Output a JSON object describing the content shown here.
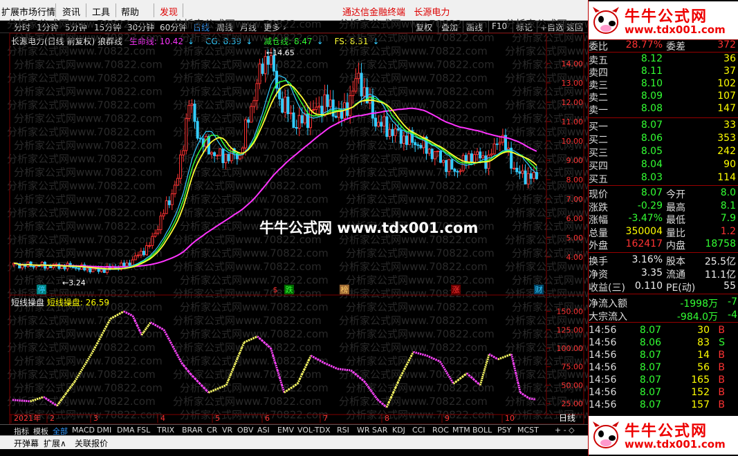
{
  "menu": {
    "items": [
      "扩展市场行情",
      "资讯",
      "工具",
      "帮助"
    ],
    "highlight": "发现",
    "center_title": "通达信金融终端",
    "stock_name": "长源电力"
  },
  "toolbar": {
    "periods": [
      "分时",
      "1分钟",
      "5分钟",
      "15分钟",
      "30分钟",
      "60分钟",
      "日线",
      "周线",
      "月线",
      "更多"
    ],
    "selected": "日线",
    "buttons": [
      "复权",
      "叠加",
      "画线",
      "F10",
      "标记",
      "+自选",
      "返回"
    ]
  },
  "main_chart": {
    "title": "长源电力(日线 前复权) 狼群线",
    "legend": [
      {
        "label": "生命线: 10.42",
        "color": "#ff33ff"
      },
      {
        "label": "CG: 8.39",
        "color": "#33ccff"
      },
      {
        "label": "减仓线: 8.47",
        "color": "#33ff33"
      },
      {
        "label": "FS: 8.31",
        "color": "#ffff33"
      }
    ],
    "arrow_glyph": "↓",
    "y_ticks": [
      "14.00",
      "13.00",
      "12.00",
      "11.00",
      "10.00",
      "9.00",
      "8.00",
      "7.00",
      "6.00",
      "5.00",
      "4.00"
    ],
    "high_label": "14.65",
    "low_label": "3.24",
    "markers": [
      {
        "text": "停",
        "color": "#33ccff",
        "box": "#008080"
      },
      {
        "text": "$",
        "color": "#ff3333",
        "box": ""
      },
      {
        "text": "跌",
        "color": "#33ff33",
        "box": "#006600"
      },
      {
        "text": "榜",
        "color": "#ffcc66",
        "box": "#996633"
      },
      {
        "text": "涨",
        "color": "#ff3333",
        "box": "#660000"
      },
      {
        "text": "财",
        "color": "#33ccff",
        "box": "#004466"
      }
    ],
    "watermark": "分析家公式网www.70822.com",
    "banner": "牛牛公式网 www.tdx001.com"
  },
  "indicator": {
    "name": "短线操盘",
    "value_label": "短线操盘: 26.59",
    "y_ticks": [
      "150.00",
      "125.00",
      "100.00",
      "75.00",
      "50.00",
      "25.00"
    ],
    "months": [
      "2021年",
      "2",
      "3",
      "4",
      "5",
      "6",
      "7",
      "8",
      "9",
      "10"
    ],
    "period_label": "日线"
  },
  "bottom_tabs": [
    "指标",
    "模板",
    "全部",
    "MACD",
    "DMI",
    "DMA",
    "FSL",
    "TRIX",
    "BRAR",
    "CR",
    "VR",
    "OBV",
    "ASI",
    "EMV",
    "VOL-TDX",
    "RSI",
    "WR",
    "SAR",
    "KDJ",
    "CCI",
    "ROC",
    "MTM",
    "BOLL",
    "PSY",
    "MCST"
  ],
  "bottom_tab_selected": "全部",
  "status": [
    "开弹幕",
    "扩展∧",
    "关联报价"
  ],
  "panel": {
    "brand_title": "牛牛公式网",
    "brand_url": "www.tdx001.com",
    "weibi": {
      "label": "委比",
      "value": "28.77%",
      "label2": "委差",
      "value2": "372"
    },
    "sell": [
      {
        "label": "卖五",
        "price": "8.12",
        "vol": "36"
      },
      {
        "label": "卖四",
        "price": "8.11",
        "vol": "37"
      },
      {
        "label": "卖三",
        "price": "8.10",
        "vol": "102"
      },
      {
        "label": "卖二",
        "price": "8.09",
        "vol": "107"
      },
      {
        "label": "卖一",
        "price": "8.08",
        "vol": "147"
      }
    ],
    "buy": [
      {
        "label": "买一",
        "price": "8.07",
        "vol": "33"
      },
      {
        "label": "买二",
        "price": "8.06",
        "vol": "353"
      },
      {
        "label": "买三",
        "price": "8.05",
        "vol": "242"
      },
      {
        "label": "买四",
        "price": "8.04",
        "vol": "90"
      },
      {
        "label": "买五",
        "price": "8.03",
        "vol": "114"
      }
    ],
    "quote": [
      {
        "l1": "现价",
        "v1": "8.07",
        "c1": "green",
        "l2": "今开",
        "v2": "8.0",
        "c2": "green"
      },
      {
        "l1": "涨跌",
        "v1": "-0.29",
        "c1": "green",
        "l2": "最高",
        "v2": "8.1",
        "c2": "green"
      },
      {
        "l1": "涨幅",
        "v1": "-3.47%",
        "c1": "green",
        "l2": "最低",
        "v2": "7.9",
        "c2": "green"
      },
      {
        "l1": "总量",
        "v1": "350004",
        "c1": "yellow",
        "l2": "量比",
        "v2": "1.2",
        "c2": "red"
      },
      {
        "l1": "外盘",
        "v1": "162417",
        "c1": "red",
        "l2": "内盘",
        "v2": "18758",
        "c2": "green"
      }
    ],
    "stats": [
      {
        "l1": "换手",
        "v1": "3.16%",
        "l2": "股本",
        "v2": "25.5亿"
      },
      {
        "l1": "净资",
        "v1": "3.35",
        "l2": "流通",
        "v2": "11.1亿"
      },
      {
        "l1": "收益(三)",
        "v1": "0.110",
        "l2": "PE(动)",
        "v2": "55"
      }
    ],
    "flows": [
      {
        "label": "净流入额",
        "value": "-1998万",
        "extra": "-7"
      },
      {
        "label": "大宗流入",
        "value": "-984.0万",
        "extra": "-4"
      }
    ],
    "ticks": [
      {
        "time": "14:56",
        "price": "8.07",
        "vol": "30",
        "side": "B"
      },
      {
        "time": "14:56",
        "price": "8.06",
        "vol": "83",
        "side": "S"
      },
      {
        "time": "14:56",
        "price": "8.07",
        "vol": "14",
        "side": "B"
      },
      {
        "time": "14:56",
        "price": "8.07",
        "vol": "56",
        "side": "B"
      },
      {
        "time": "14:56",
        "price": "8.07",
        "vol": "165",
        "side": "B"
      },
      {
        "time": "14:56",
        "price": "8.07",
        "vol": "152",
        "side": "B"
      },
      {
        "time": "14:56",
        "price": "8.07",
        "vol": "157",
        "side": "B"
      }
    ]
  },
  "colors": {
    "up": "#ff3333",
    "down": "#33ccff",
    "life_line": "#ff33ff",
    "fs_line": "#ffff33",
    "grid": "#800000"
  }
}
